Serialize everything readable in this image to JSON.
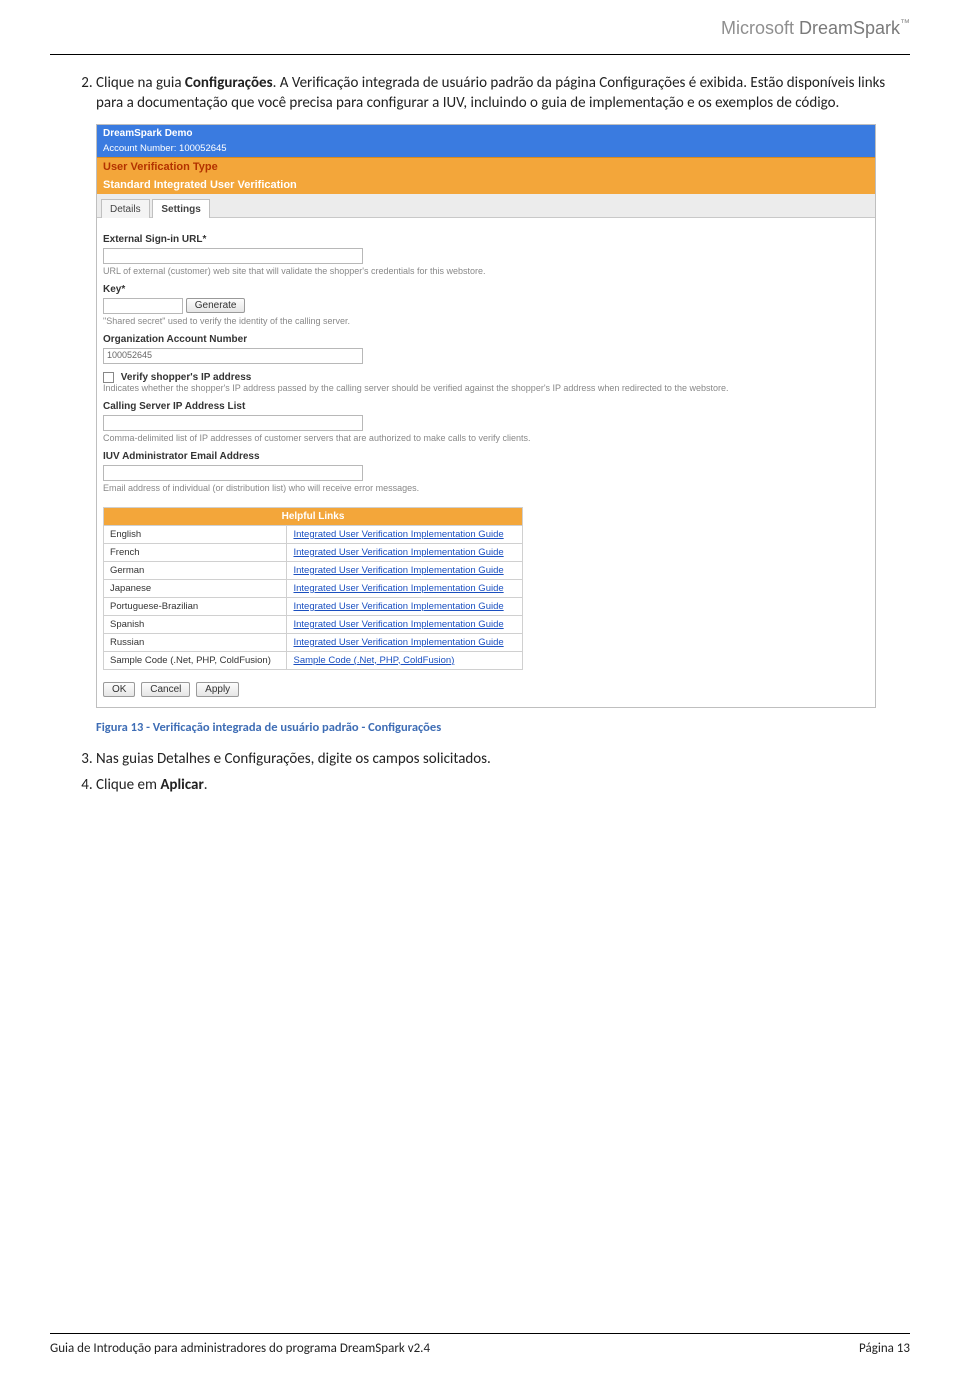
{
  "brand": {
    "prefix": "Microsoft ",
    "name": "DreamSpark",
    "tm": "™"
  },
  "list": {
    "item2_a": "Clique na guia ",
    "item2_bold": "Configurações",
    "item2_b": ". A Verificação integrada de usuário padrão da página Configurações é exibida. Estão disponíveis links para a documentação que você precisa para configurar a IUV, incluindo o guia de implementação e os exemplos de código.",
    "item3": "Nas guias Detalhes e Configurações, digite os campos solicitados.",
    "item4_a": "Clique em ",
    "item4_bold": "Aplicar",
    "item4_b": "."
  },
  "caption": "Figura 13 - Verificação integrada de usuário padrão - Configurações",
  "shot": {
    "header1": "DreamSpark Demo",
    "header2": "Account Number: 100052645",
    "orange1": "User Verification Type",
    "orange2": "Standard Integrated User Verification",
    "tab_details": "Details",
    "tab_settings": "Settings",
    "lbl_signin": "External Sign-in URL*",
    "help_signin": "URL of external (customer) web site that will validate the shopper's credentials for this webstore.",
    "lbl_key": "Key*",
    "btn_generate": "Generate",
    "help_key": "\"Shared secret\" used to verify the identity of the calling server.",
    "lbl_org": "Organization Account Number",
    "val_org": "100052645",
    "lbl_verifyip": "Verify shopper's IP address",
    "help_verifyip": "Indicates whether the shopper's IP address passed by the calling server should be verified against the shopper's IP address when redirected to the webstore.",
    "lbl_iplist": "Calling Server IP Address List",
    "help_iplist": "Comma-delimited list of IP addresses of customer servers that are authorized to make calls to verify clients.",
    "lbl_email": "IUV Administrator Email Address",
    "help_email": "Email address of individual (or distribution list) who will receive error messages.",
    "links_header": "Helpful Links",
    "links": [
      {
        "lang": "English",
        "text": "Integrated User Verification Implementation Guide"
      },
      {
        "lang": "French",
        "text": "Integrated User Verification Implementation Guide"
      },
      {
        "lang": "German",
        "text": "Integrated User Verification Implementation Guide"
      },
      {
        "lang": "Japanese",
        "text": "Integrated User Verification Implementation Guide"
      },
      {
        "lang": "Portuguese-Brazilian",
        "text": "Integrated User Verification Implementation Guide"
      },
      {
        "lang": "Spanish",
        "text": "Integrated User Verification Implementation Guide"
      },
      {
        "lang": "Russian",
        "text": "Integrated User Verification Implementation Guide"
      },
      {
        "lang": "Sample Code (.Net, PHP, ColdFusion)",
        "text": "Sample Code (.Net, PHP, ColdFusion)"
      }
    ],
    "btn_ok": "OK",
    "btn_cancel": "Cancel",
    "btn_apply": "Apply"
  },
  "footer": {
    "left": "Guia de Introdução para administradores do programa DreamSpark v2.4",
    "right": "Página 13"
  }
}
